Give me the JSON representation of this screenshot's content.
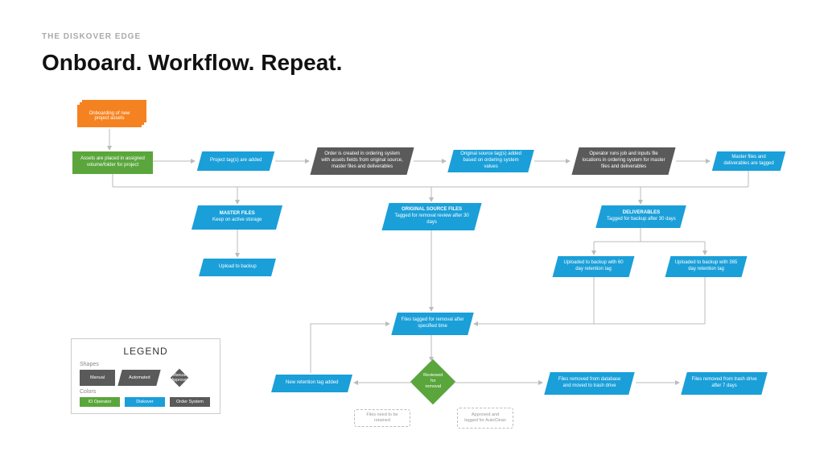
{
  "eyebrow": "THE DISKOVER EDGE",
  "title": "Onboard. Workflow. Repeat.",
  "nodes": {
    "onboard": "Onboarding of new project assets",
    "assets_placed": "Assets are placed in assigned volume/folder for project",
    "project_tags": "Project tag(s) are added",
    "order_created": "Order is created in ordering system with assets fields from original source, master files and deliverables",
    "source_tags": "Original source tag(s) added based on ordering system values",
    "operator_runs": "Operator runs job and inputs file locations in ordering system for master files and deliverables",
    "master_deliv_tagged": "Master files and deliverables are tagged",
    "master_files": "MASTER FILES",
    "master_files_sub": "Keep on active storage",
    "upload_backup": "Upload to backup",
    "orig_source": "ORIGINAL SOURCE FILES",
    "orig_source_sub": "Tagged for removal review after 30 days",
    "deliverables": "DELIVERABLES",
    "deliverables_sub": "Tagged for backup after 30 days",
    "uploaded_60": "Uploaded to backup with 60 day retention tag",
    "uploaded_365": "Uploaded to backup with 365 day retention tag",
    "files_tagged_removal": "Files tagged for removal after specified time",
    "new_retention": "New retention tag added",
    "reviewed": "Reviewed for removal",
    "files_removed_db": "Files removed from database and moved to trash drive",
    "files_removed_trash": "Files removed from trash drive after 7 days",
    "need_retain": "Files need to be retained",
    "approved_clean": "Approved and tagged for AutoClean"
  },
  "legend": {
    "title": "LEGEND",
    "shapes_label": "Shapes",
    "colors_label": "Colors",
    "manual": "Manual",
    "automated": "Automated",
    "manual_approval": "Manual Approval",
    "io_operator": "IO Operator",
    "diskover": "Diskover",
    "order_system": "Order System"
  }
}
